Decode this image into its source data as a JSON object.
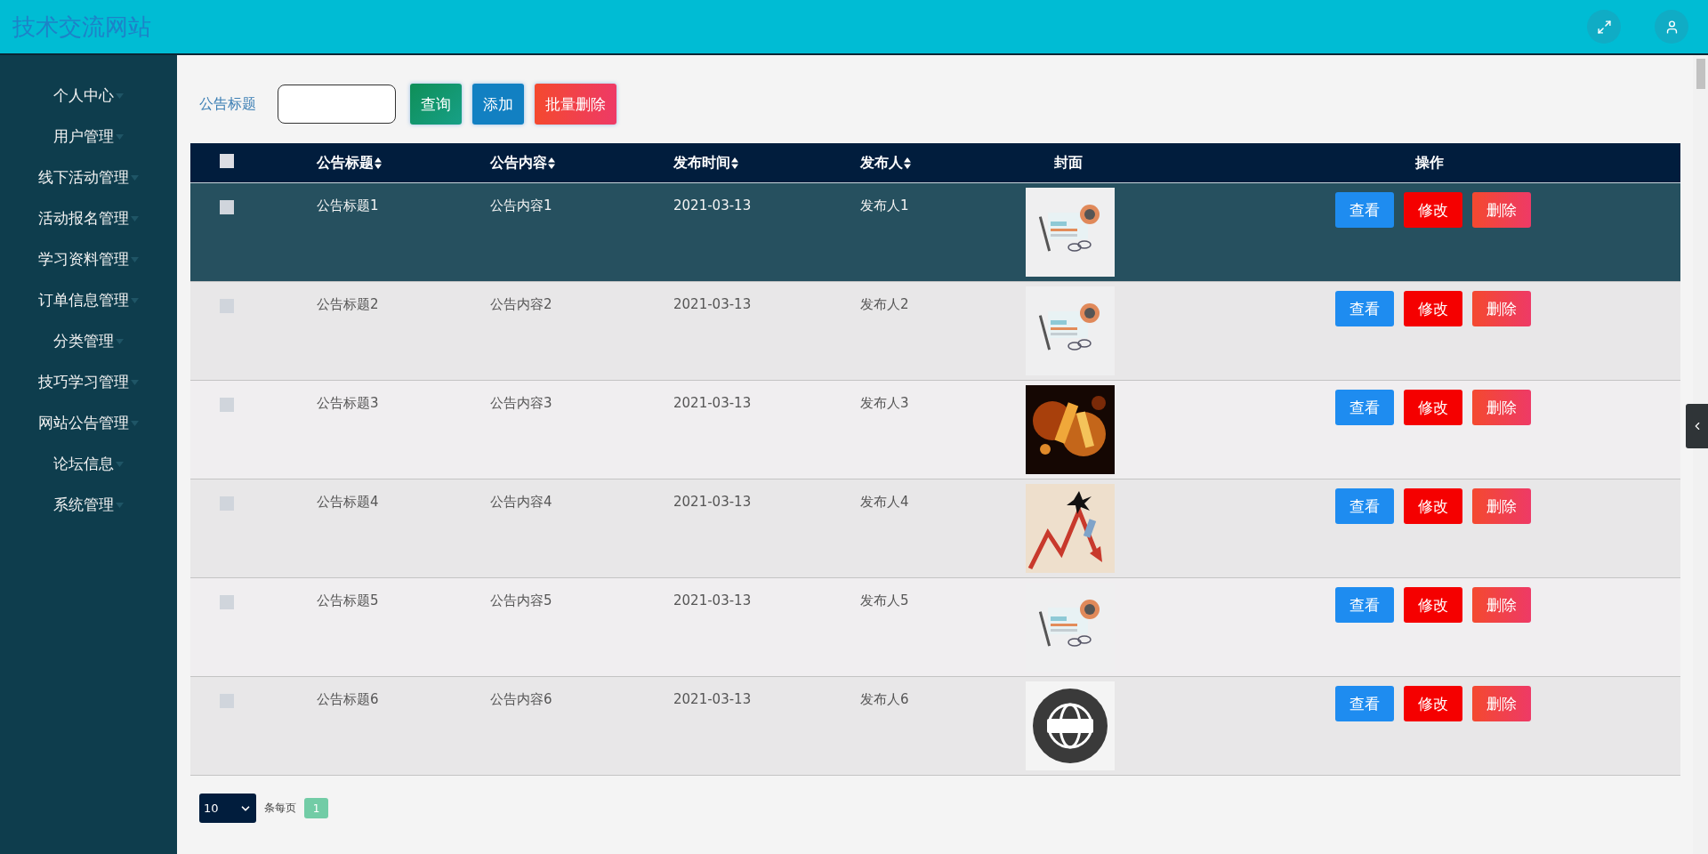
{
  "header": {
    "title": "技术交流网站"
  },
  "sidebar": {
    "items": [
      {
        "label": "个人中心"
      },
      {
        "label": "用户管理"
      },
      {
        "label": "线下活动管理"
      },
      {
        "label": "活动报名管理"
      },
      {
        "label": "学习资料管理"
      },
      {
        "label": "订单信息管理"
      },
      {
        "label": "分类管理"
      },
      {
        "label": "技巧学习管理"
      },
      {
        "label": "网站公告管理"
      },
      {
        "label": "论坛信息"
      },
      {
        "label": "系统管理"
      }
    ]
  },
  "search": {
    "label": "公告标题",
    "buttons": [
      {
        "label": "查询",
        "kind": "search"
      },
      {
        "label": "添加",
        "kind": "add"
      },
      {
        "label": "批量删除",
        "kind": "batch-delete"
      }
    ]
  },
  "table": {
    "select_all": {
      "checked": false
    },
    "columns": [
      {
        "label": "公告标题",
        "sortable": true
      },
      {
        "label": "公告内容",
        "sortable": true
      },
      {
        "label": "发布时间",
        "sortable": true
      },
      {
        "label": "发布人",
        "sortable": true
      },
      {
        "label": "封面",
        "sortable": false
      },
      {
        "label": "操作",
        "sortable": false
      }
    ],
    "rows": [
      {
        "checked": false,
        "hovered": true,
        "title": "公告标题1",
        "content": "公告内容1",
        "time": "2021-03-13",
        "publisher": "发布人1",
        "actions": [
          {
            "label": "查看",
            "kind": "view"
          },
          {
            "label": "修改",
            "kind": "edit"
          },
          {
            "label": "删除",
            "kind": "delete"
          }
        ]
      },
      {
        "checked": false,
        "hovered": false,
        "title": "公告标题2",
        "content": "公告内容2",
        "time": "2021-03-13",
        "publisher": "发布人2",
        "actions": [
          {
            "label": "查看",
            "kind": "view"
          },
          {
            "label": "修改",
            "kind": "edit"
          },
          {
            "label": "删除",
            "kind": "delete"
          }
        ]
      },
      {
        "checked": false,
        "hovered": false,
        "title": "公告标题3",
        "content": "公告内容3",
        "time": "2021-03-13",
        "publisher": "发布人3",
        "actions": [
          {
            "label": "查看",
            "kind": "view"
          },
          {
            "label": "修改",
            "kind": "edit"
          },
          {
            "label": "删除",
            "kind": "delete"
          }
        ]
      },
      {
        "checked": false,
        "hovered": false,
        "title": "公告标题4",
        "content": "公告内容4",
        "time": "2021-03-13",
        "publisher": "发布人4",
        "actions": [
          {
            "label": "查看",
            "kind": "view"
          },
          {
            "label": "修改",
            "kind": "edit"
          },
          {
            "label": "删除",
            "kind": "delete"
          }
        ]
      },
      {
        "checked": false,
        "hovered": false,
        "title": "公告标题5",
        "content": "公告内容5",
        "time": "2021-03-13",
        "publisher": "发布人5",
        "actions": [
          {
            "label": "查看",
            "kind": "view"
          },
          {
            "label": "修改",
            "kind": "edit"
          },
          {
            "label": "删除",
            "kind": "delete"
          }
        ]
      },
      {
        "checked": false,
        "hovered": false,
        "title": "公告标题6",
        "content": "公告内容6",
        "time": "2021-03-13",
        "publisher": "发布人6",
        "actions": [
          {
            "label": "查看",
            "kind": "view"
          },
          {
            "label": "修改",
            "kind": "edit"
          },
          {
            "label": "删除",
            "kind": "delete"
          }
        ]
      }
    ]
  },
  "pagination": {
    "page_size": "10",
    "per_page_label": "条每页",
    "pages": [
      {
        "label": "1",
        "selected": true
      }
    ]
  }
}
